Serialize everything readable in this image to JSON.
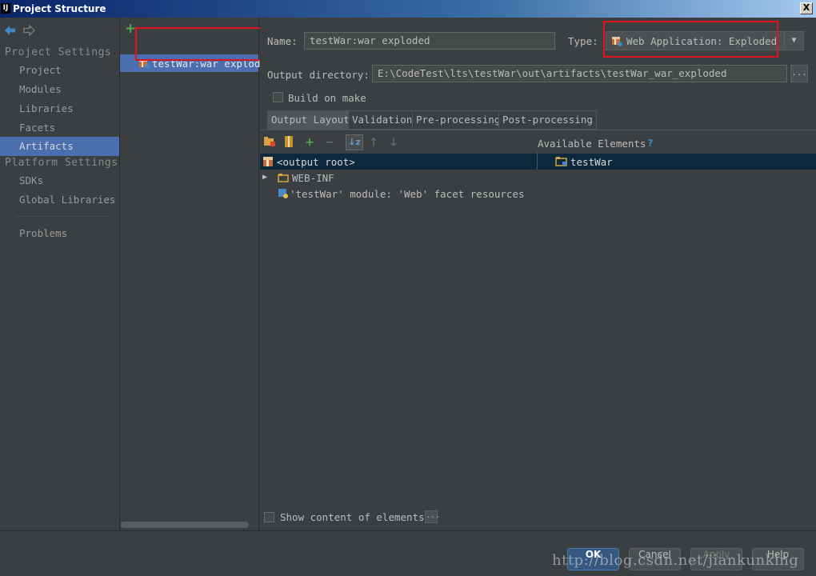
{
  "window": {
    "app_badge": "IJ",
    "title": "Project Structure",
    "close_glyph": "X"
  },
  "nav": {
    "back_icon": "back-arrow-icon",
    "forward_icon": "forward-arrow-icon",
    "section_project": "Project Settings",
    "project_items": [
      "Project",
      "Modules",
      "Libraries",
      "Facets",
      "Artifacts"
    ],
    "section_platform": "Platform Settings",
    "platform_items": [
      "SDKs",
      "Global Libraries"
    ],
    "problems": "Problems",
    "selected": "Artifacts"
  },
  "artifacts": {
    "add_glyph": "+",
    "items": [
      "testWar:war exploded"
    ]
  },
  "form": {
    "name_label": "Name:",
    "name_value": "testWar:war exploded",
    "type_label": "Type:",
    "type_value": "Web Application: Exploded",
    "output_dir_label": "Output directory:",
    "output_dir_value": "E:\\CodeTest\\lts\\testWar\\out\\artifacts\\testWar_war_exploded",
    "browse_label": "...",
    "build_on_make": "Build on make",
    "build_on_make_checked": false
  },
  "tabs": [
    "Output Layout",
    "Validation",
    "Pre-processing",
    "Post-processing"
  ],
  "layout": {
    "available_label": "Available Elements",
    "help_glyph": "?",
    "tree": [
      {
        "label": "<output root>",
        "icon": "war-icon"
      },
      {
        "label": "WEB-INF",
        "icon": "folder-icon",
        "expandable": true
      },
      {
        "label": "'testWar' module: 'Web' facet resources",
        "icon": "web-facet-icon"
      }
    ],
    "available": [
      {
        "label": "testWar",
        "icon": "module-folder-icon"
      }
    ],
    "show_content_label": "Show content of elements",
    "show_content_checked": false,
    "show_content_more": "..."
  },
  "buttons": {
    "ok": "OK",
    "cancel": "Cancel",
    "apply": "Apply",
    "help": "Help"
  },
  "watermark": "http://blog.csdn.net/jiankunking",
  "colors": {
    "selection": "#4b6eaf",
    "highlight_box": "#e0141e",
    "background": "#3c3f41",
    "add_green": "#4fae4c"
  }
}
